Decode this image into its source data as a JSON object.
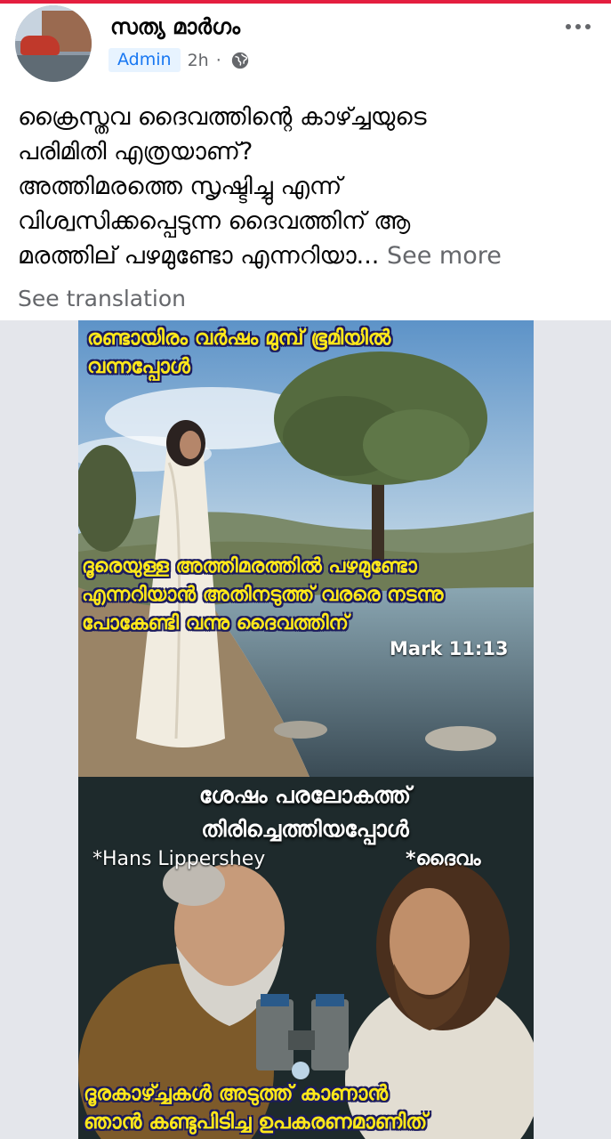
{
  "post": {
    "page_name": "സത്യ മാർഗം",
    "role_badge": "Admin",
    "time": "2h",
    "separator": "·",
    "privacy_icon": "globe-icon",
    "more_icon": "ellipsis-icon",
    "text_lines": [
      "ക്രൈസ്തവ ദൈവത്തിന്റെ കാഴ്ച്ചയുടെ",
      "പരിമിതി എത്രയാണ്?",
      "അത്തിമരത്തെ സൃഷ്ടിച്ചു എന്ന്",
      "വിശ്വസിക്കപ്പെടുന്ന ദൈവത്തിന് ആ",
      "മരത്തില് പഴമുണ്ടോ എന്നറിയാ..."
    ],
    "see_more": "See more",
    "see_translation": "See translation"
  },
  "meme": {
    "top_caption": [
      "രണ്ടായിരം വർഷം മുമ്പ് ഭൂമിയിൽ",
      "വന്നപ്പോൾ"
    ],
    "middle_caption": [
      "ദൂരെയുള്ള അത്തിമരത്തിൽ പഴമുണ്ടോ",
      "എന്നറിയാൻ അതിനടുത്ത് വരരെ നടന്നു",
      "പോകേണ്ടി വന്നു ദൈവത്തിന്"
    ],
    "reference": "Mark 11:13",
    "bottom_title": [
      "ശേഷം പരലോകത്ത്",
      "തിരിച്ചെത്തിയപ്പോൾ"
    ],
    "label_left": "*Hans Lippershey",
    "label_right": "*ദൈവം",
    "bottom_caption": [
      "ദൂരകാഴ്ച്ചകൾ അടുത്ത് കാണാൻ",
      "ഞാൻ കണ്ടുപിടിച്ച ഉപകരണമാണിത്"
    ]
  },
  "colors": {
    "accent_bar": "#e41e3f",
    "badge_text": "#1877f2",
    "badge_bg": "#e7f3ff",
    "caption_yellow": "#ffe81a",
    "caption_outline": "#1b1b5e",
    "meta_gray": "#65676b"
  }
}
